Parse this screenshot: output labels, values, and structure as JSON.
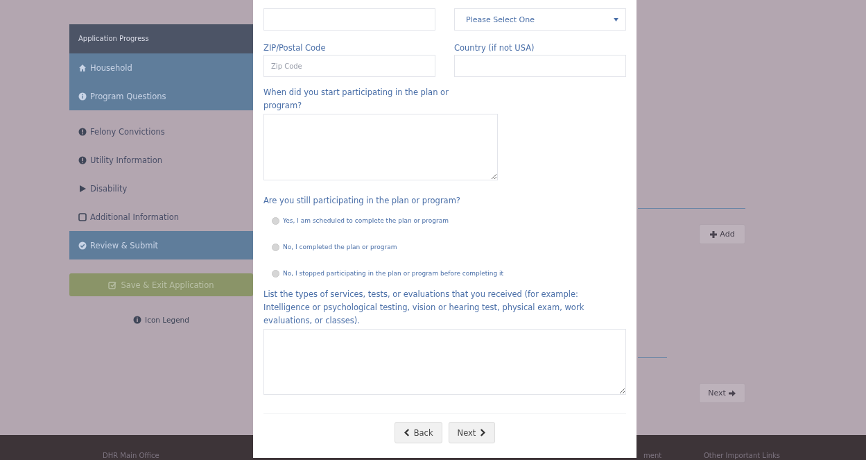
{
  "sidebar": {
    "title": "Application Progress",
    "items": [
      {
        "label": "Household",
        "kind": "home",
        "highlighted": true
      },
      {
        "label": "Program Questions",
        "kind": "info",
        "highlighted": true
      },
      {
        "label": "Felony Convictions",
        "kind": "alert",
        "highlighted": false
      },
      {
        "label": "Utility Information",
        "kind": "alert",
        "highlighted": false
      },
      {
        "label": "Disability",
        "kind": "play",
        "highlighted": false
      },
      {
        "label": "Additional Information",
        "kind": "box",
        "highlighted": false
      },
      {
        "label": "Review & Submit",
        "kind": "check",
        "highlighted": true
      }
    ],
    "save_button": "Save & Exit Application",
    "legend": "Icon Legend"
  },
  "background_buttons": {
    "add": "Add",
    "next": "Next"
  },
  "modal": {
    "select": {
      "placeholder": "Please Select One"
    },
    "zip": {
      "label": "ZIP/Postal Code",
      "placeholder": "Zip Code"
    },
    "country": {
      "label": "Country (if not USA)"
    },
    "start_question": "When did you start participating in the plan or program?",
    "still_question": "Are you still participating in the plan or program?",
    "options": [
      {
        "label": "Yes, I am scheduled to complete the plan or program",
        "selected": false
      },
      {
        "label": "No, I completed the plan or program",
        "selected": false
      },
      {
        "label": "No, I stopped participating in the plan or program before completing it",
        "selected": false
      }
    ],
    "services_question": "List the types of services, tests, or evaluations that you received (for example: Intelligence or psychological testing, vision or hearing test, physical exam, work evaluations, or classes).",
    "back": "Back",
    "next": "Next"
  },
  "footer": {
    "links": [
      "DHR Main Office",
      "ment",
      "Other Important Links"
    ]
  }
}
